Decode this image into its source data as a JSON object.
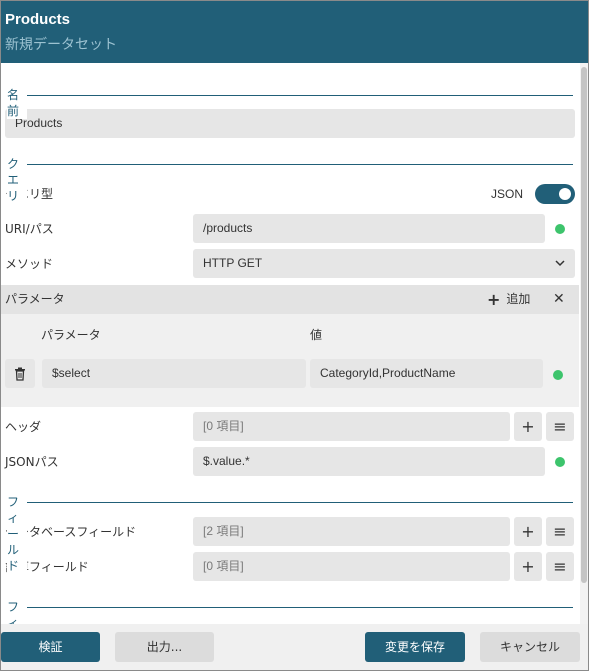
{
  "header": {
    "title": "Products",
    "subtitle": "新規データセット"
  },
  "name_section": {
    "heading": "名前",
    "value": "Products"
  },
  "query_section": {
    "heading": "クエリ",
    "query_type_label": "クエリ型",
    "query_type_value": "JSON",
    "uri_label": "URI/パス",
    "uri_value": "/products",
    "method_label": "メソッド",
    "method_value": "HTTP GET"
  },
  "parameters": {
    "label": "パラメータ",
    "add_label": "追加",
    "col_name": "パラメータ",
    "col_value": "値",
    "rows": [
      {
        "name": "$select",
        "value": "CategoryId,ProductName"
      }
    ]
  },
  "headers": {
    "label": "ヘッダ",
    "value": "[0 項目]"
  },
  "json_path": {
    "label": "JSONパス",
    "value": "$.value.*"
  },
  "fields_section": {
    "heading": "フィールド",
    "db_fields_label": "データベースフィールド",
    "db_fields_value": "[2 項目]",
    "calc_fields_label": "計算フィールド",
    "calc_fields_value": "[0 項目]"
  },
  "filter_section": {
    "heading": "フィルタ"
  },
  "footer": {
    "validate": "検証",
    "output": "出力...",
    "save": "変更を保存",
    "cancel": "キャンセル"
  },
  "colors": {
    "accent": "#215f78",
    "status_ok": "#3dc46c",
    "field_bg": "#e6e6e6"
  }
}
